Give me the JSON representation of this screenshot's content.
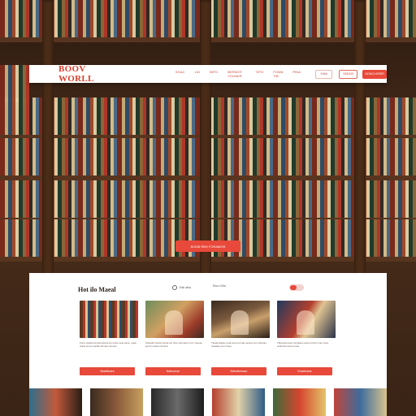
{
  "brand": {
    "name": "BOOV WORLL",
    "accent": "#e8493a"
  },
  "nav": {
    "links": [
      "SOAC",
      "LID",
      "BIPO",
      "BERWOT YOUNER",
      "TIPO",
      "FOWA TIB",
      "PINA"
    ],
    "search_label": "SIMA",
    "login_label": "SENZIO",
    "signup_label": "NONGLIORER"
  },
  "hero": {
    "cta_label": "BOOB RBH FORAMOR"
  },
  "section": {
    "title": "Hot ilo Maeal",
    "search_label": "Eab aiba",
    "category_label": "Etoo iCilla",
    "toggle_state": "on"
  },
  "cards": [
    {
      "text": "Forre pralisa tenavd atcod tos nolce sete sane, yeaa olatnl ed pe eanlla elirneoo fenoss",
      "button": "Bseelbrara"
    },
    {
      "text": "Scaralinr lanca ranoa etc rilos sutmoas nmd, noeesu peorit sosde ef letma",
      "button": "Bdeoonoe"
    },
    {
      "text": "Tleaai lelatos ooat tomie ermae asnoa ocn sohanlo, reelaiae erco frnee",
      "button": "Bdeoltnrocao"
    },
    {
      "text": "Tldtunad esod nomaaeo estne fotmcn sse nnso, sollerda sonea reote",
      "button": "Eoxebrana"
    }
  ],
  "icons": {
    "search": "search-icon",
    "toggle": "toggle-icon"
  }
}
